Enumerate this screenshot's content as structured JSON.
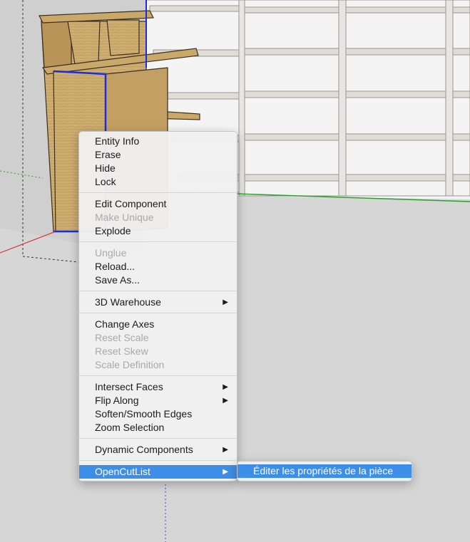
{
  "context_menu": {
    "groups": [
      [
        {
          "label": "Entity Info",
          "enabled": true
        },
        {
          "label": "Erase",
          "enabled": true
        },
        {
          "label": "Hide",
          "enabled": true
        },
        {
          "label": "Lock",
          "enabled": true
        }
      ],
      [
        {
          "label": "Edit Component",
          "enabled": true
        },
        {
          "label": "Make Unique",
          "enabled": false
        },
        {
          "label": "Explode",
          "enabled": true
        }
      ],
      [
        {
          "label": "Unglue",
          "enabled": false
        },
        {
          "label": "Reload...",
          "enabled": true
        },
        {
          "label": "Save As...",
          "enabled": true
        }
      ],
      [
        {
          "label": "3D Warehouse",
          "enabled": true,
          "submenu": true
        }
      ],
      [
        {
          "label": "Change Axes",
          "enabled": true
        },
        {
          "label": "Reset Scale",
          "enabled": false
        },
        {
          "label": "Reset Skew",
          "enabled": false
        },
        {
          "label": "Scale Definition",
          "enabled": false
        }
      ],
      [
        {
          "label": "Intersect Faces",
          "enabled": true,
          "submenu": true
        },
        {
          "label": "Flip Along",
          "enabled": true,
          "submenu": true
        },
        {
          "label": "Soften/Smooth Edges",
          "enabled": true
        },
        {
          "label": "Zoom Selection",
          "enabled": true
        }
      ],
      [
        {
          "label": "Dynamic Components",
          "enabled": true,
          "submenu": true
        }
      ],
      [
        {
          "label": "OpenCutList",
          "enabled": true,
          "submenu": true,
          "highlighted": true
        }
      ]
    ]
  },
  "submenu": {
    "items": [
      {
        "label": "Éditer les propriétés de la pièce",
        "highlighted": true
      }
    ]
  },
  "colors": {
    "highlight": "#3d8ee8",
    "wood": "#c9a86a",
    "selection_edge": "#1a2de0",
    "axis_red": "#d42020",
    "axis_green": "#2aa02a",
    "shelf_frame": "#e8e6e2"
  },
  "icons": {
    "submenu_arrow": "▶"
  }
}
